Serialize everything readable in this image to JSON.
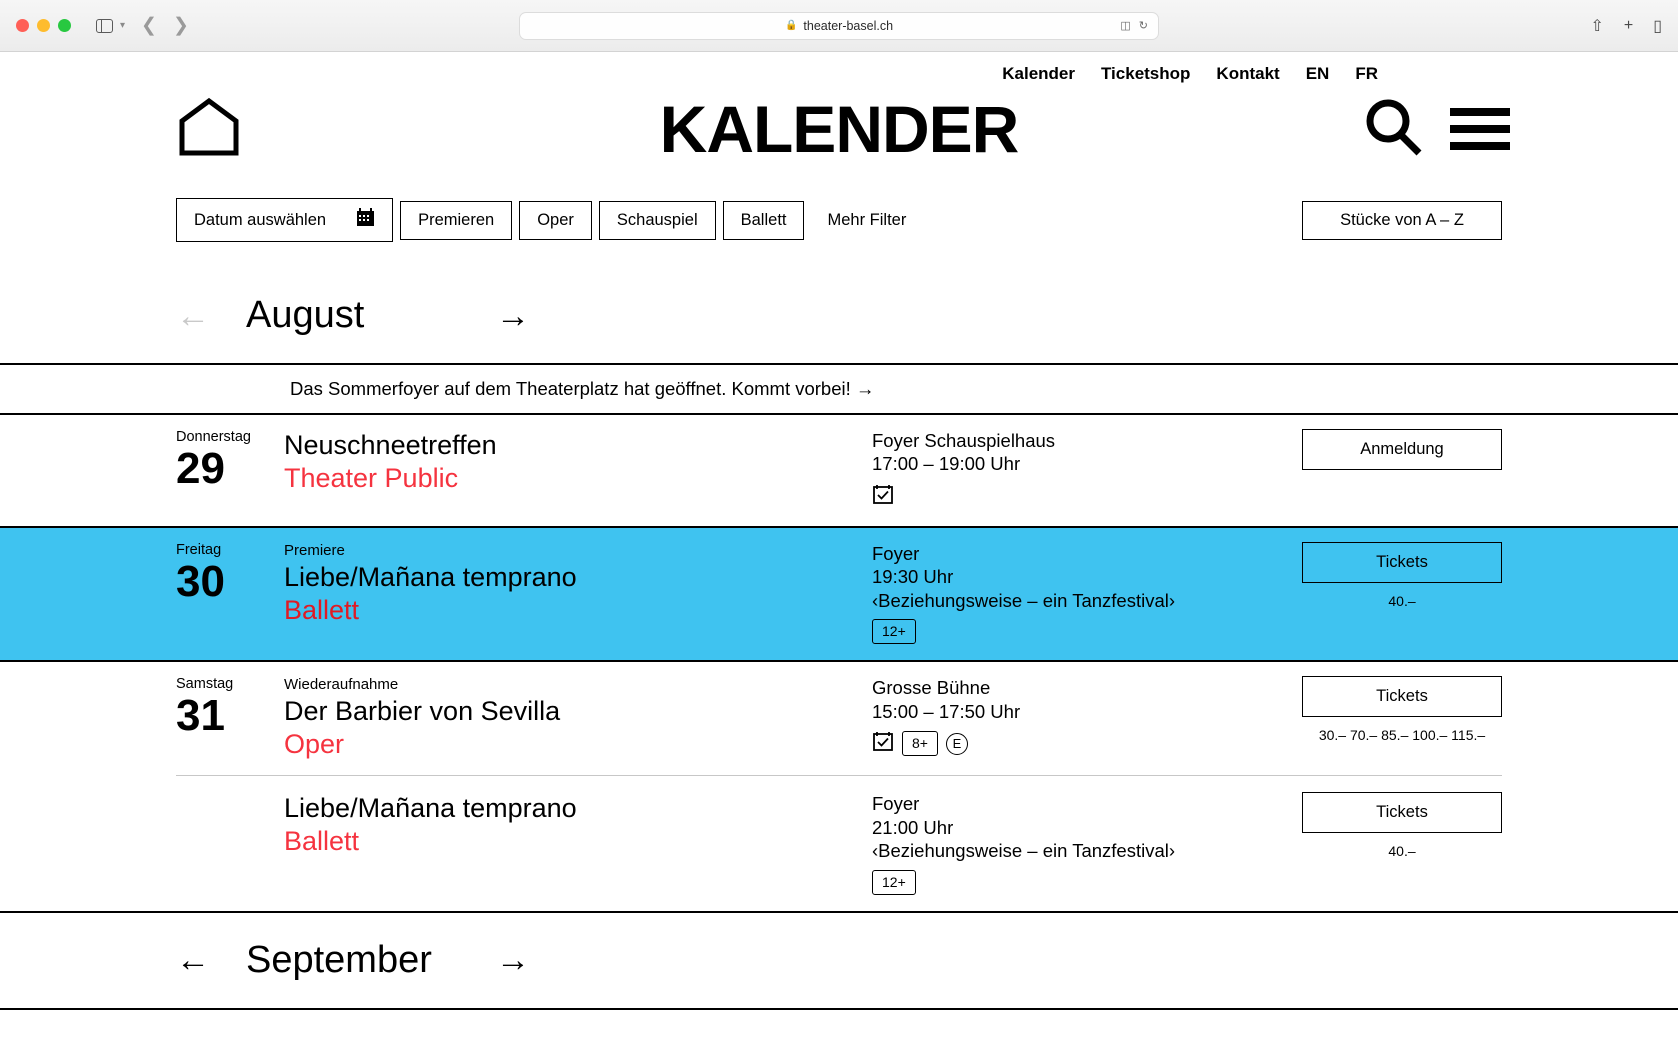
{
  "browser": {
    "url": "theater-basel.ch",
    "lock_icon": "lock-icon",
    "reader_icon": "reader-icon",
    "reload_icon": "reload-icon",
    "share_icon": "share-icon",
    "newtab_icon": "plus-icon",
    "tabs_icon": "tabs-icon"
  },
  "topnav": {
    "items": [
      {
        "label": "Kalender"
      },
      {
        "label": "Ticketshop"
      },
      {
        "label": "Kontakt"
      },
      {
        "label": "EN"
      },
      {
        "label": "FR"
      }
    ]
  },
  "masthead": {
    "home_icon": "home-icon",
    "title": "KALENDER",
    "search_icon": "search-icon",
    "menu_icon": "hamburger-menu-icon"
  },
  "filters": {
    "date_picker_label": "Datum auswählen",
    "calendar_icon": "calendar-icon",
    "chips": [
      {
        "label": "Premieren"
      },
      {
        "label": "Oper"
      },
      {
        "label": "Schauspiel"
      },
      {
        "label": "Ballett"
      }
    ],
    "more_filters_label": "Mehr Filter",
    "az_button_label": "Stücke von A – Z"
  },
  "month_nav": {
    "prev_arrow": "←",
    "label": "August",
    "next_arrow": "→"
  },
  "banner": {
    "text": "Das Sommerfoyer auf dem Theaterplatz hat geöffnet. Kommt vorbei! →"
  },
  "events": [
    {
      "weekday": "Donnerstag",
      "day": "29",
      "kicker": "",
      "title": "Neuschneetreffen",
      "genre": "Theater Public",
      "venue": "Foyer Schauspielhaus",
      "time": "17:00 – 19:00 Uhr",
      "subtitle": "",
      "badges": [
        {
          "type": "calendar-check",
          "label": ""
        }
      ],
      "action_label": "Anmeldung",
      "price": "",
      "highlighted": false
    },
    {
      "weekday": "Freitag",
      "day": "30",
      "kicker": "Premiere",
      "title": "Liebe/Mañana temprano",
      "genre": "Ballett",
      "venue": "Foyer",
      "time": "19:30 Uhr",
      "subtitle": "‹Beziehungsweise – ein Tanzfestival›",
      "badges": [
        {
          "type": "box",
          "label": "12+"
        }
      ],
      "action_label": "Tickets",
      "price": "40.–",
      "highlighted": true
    },
    {
      "weekday": "Samstag",
      "day": "31",
      "kicker": "Wiederaufnahme",
      "title": "Der Barbier von Sevilla",
      "genre": "Oper",
      "venue": "Grosse Bühne",
      "time": "15:00 – 17:50 Uhr",
      "subtitle": "",
      "badges": [
        {
          "type": "calendar-check",
          "label": ""
        },
        {
          "type": "box",
          "label": "8+"
        },
        {
          "type": "circle",
          "label": "E"
        }
      ],
      "action_label": "Tickets",
      "price": "30.– 70.– 85.– 100.– 115.–",
      "highlighted": false
    }
  ],
  "sub_event": {
    "kicker": "",
    "title": "Liebe/Mañana temprano",
    "genre": "Ballett",
    "venue": "Foyer",
    "time": "21:00 Uhr",
    "subtitle": "‹Beziehungsweise – ein Tanzfestival›",
    "badges": [
      {
        "type": "box",
        "label": "12+"
      }
    ],
    "action_label": "Tickets",
    "price": "40.–"
  },
  "footer_nav": {
    "prev_arrow": "←",
    "label": "September",
    "next_arrow": "→"
  },
  "colors": {
    "accent_red": "#f5333f",
    "highlight_blue": "#3fc3f0",
    "black": "#000000"
  }
}
